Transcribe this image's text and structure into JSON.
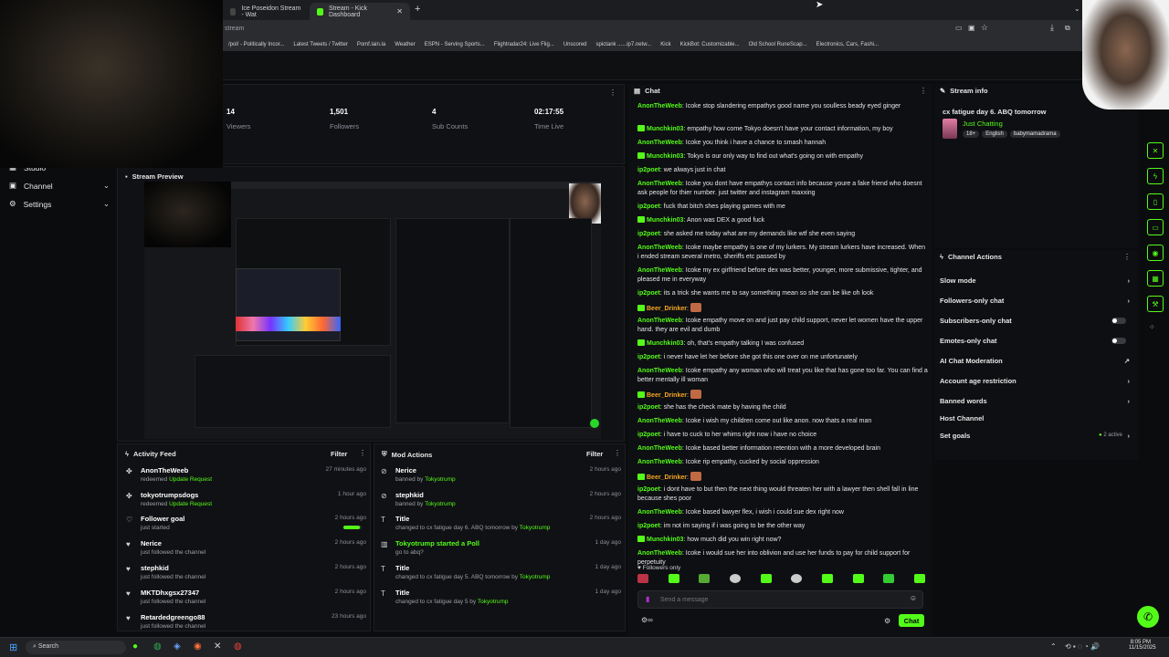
{
  "browser": {
    "tabs": [
      {
        "label": "Ice Poseidon Stream - Wat"
      },
      {
        "label": "Stream - Kick Dashboard"
      }
    ],
    "url_fragment": "stream",
    "bookmarks": [
      "/pol/ - Politically Incor...",
      "Latest Tweets / Twitter",
      "Pomf.lain.la",
      "Weather",
      "ESPN - Serving Sports...",
      "Flightradar24: Live Flig...",
      "Unscored",
      "spictank ......ip7.netw...",
      "Kick",
      "KickBot: Customizable...",
      "Old School RuneScap...",
      "Electronics, Cars, Fashi..."
    ]
  },
  "leftnav": {
    "items": [
      {
        "label": "Studio"
      },
      {
        "label": "Channel"
      },
      {
        "label": "Settings"
      }
    ]
  },
  "stats": [
    {
      "value": "14",
      "label": "Viewers"
    },
    {
      "value": "1,501",
      "label": "Followers"
    },
    {
      "value": "4",
      "label": "Sub Counts"
    },
    {
      "value": "02:17:55",
      "label": "Time Live"
    }
  ],
  "preview": {
    "title": "Stream Preview"
  },
  "activity_feed": {
    "title": "Activity Feed",
    "filter": "Filter",
    "items": [
      {
        "icon": "gift",
        "name": "AnonTheWeeb",
        "sub": "redeemed",
        "sub_hl": "Update Request",
        "time": "27 minutes ago"
      },
      {
        "icon": "gift",
        "name": "tokyotrumpsdogs",
        "sub": "redeemed",
        "sub_hl": "Update Request",
        "time": "1 hour ago"
      },
      {
        "icon": "heart-outline",
        "name": "Follower goal",
        "sub": "just started",
        "sub_hl": "",
        "time": "2 hours ago",
        "progress": 0.9
      },
      {
        "icon": "heart",
        "name": "Nerice",
        "sub": "just followed the channel",
        "sub_hl": "",
        "time": "2 hours ago"
      },
      {
        "icon": "heart",
        "name": "stephkid",
        "sub": "just followed the channel",
        "sub_hl": "",
        "time": "2 hours ago"
      },
      {
        "icon": "heart",
        "name": "MKTDhxgsx27347",
        "sub": "just followed the channel",
        "sub_hl": "",
        "time": "2 hours ago"
      },
      {
        "icon": "heart",
        "name": "Retardedgreengo88",
        "sub": "just followed the channel",
        "sub_hl": "",
        "time": "23 hours ago"
      }
    ]
  },
  "mod_actions": {
    "title": "Mod Actions",
    "filter": "Filter",
    "items": [
      {
        "icon": "ban",
        "name": "Nerice",
        "sub": "banned by",
        "by": "Tokyotrump",
        "time": "2 hours ago"
      },
      {
        "icon": "ban",
        "name": "stephkid",
        "sub": "banned by",
        "by": "Tokyotrump",
        "time": "2 hours ago"
      },
      {
        "icon": "title",
        "name": "Title",
        "sub": "changed to cx fatigue day 6. ABQ tomorrow by",
        "by": "Tokyotrump",
        "time": "2 hours ago"
      },
      {
        "icon": "poll",
        "name": "Tokyotrump started a Poll",
        "sub": "go to abq?",
        "by": "",
        "time": "1 day ago"
      },
      {
        "icon": "title",
        "name": "Title",
        "sub": "changed to cx fatigue day 5. ABQ tomorrow by",
        "by": "Tokyotrump",
        "time": "1 day ago"
      },
      {
        "icon": "title",
        "name": "Title",
        "sub": "changed to cx fatigue day 5 by",
        "by": "Tokyotrump",
        "time": "1 day ago"
      }
    ]
  },
  "chat": {
    "title": "Chat",
    "followers_only": "Followers only",
    "placeholder": "Send a message",
    "send": "Chat",
    "messages": [
      {
        "user": "AnonTheWeeb",
        "color": "#53fc18",
        "badge": false,
        "text": "Icoke stop slandering empathys good name you soulless beady eyed ginger"
      },
      {
        "user": "Munchkin03",
        "color": "#53fc18",
        "badge": true,
        "text": "empathy how come Tokyo doesn't have your contact information, my boy"
      },
      {
        "user": "AnonTheWeeb",
        "color": "#53fc18",
        "badge": false,
        "text": "Icoke you think i have a chance to smash hannah"
      },
      {
        "user": "Munchkin03",
        "color": "#53fc18",
        "badge": true,
        "text": "Tokyo is our only way to find out what's going on with empathy"
      },
      {
        "user": "ip2poet",
        "color": "#53fc18",
        "badge": false,
        "text": "we always just in chat"
      },
      {
        "user": "AnonTheWeeb",
        "color": "#53fc18",
        "badge": false,
        "text": "Icoke you dont have empathys contact info because youre a fake friend who doesnt ask people for thier number. just twitter and instagram maxxing"
      },
      {
        "user": "ip2poet",
        "color": "#53fc18",
        "badge": false,
        "text": "fuck that bitch shes playing games with me"
      },
      {
        "user": "Munchkin03",
        "color": "#53fc18",
        "badge": true,
        "text": "Anon was DEX a good fuck"
      },
      {
        "user": "ip2poet",
        "color": "#53fc18",
        "badge": false,
        "text": "she asked me today what are my demands like wtf she even saying"
      },
      {
        "user": "AnonTheWeeb",
        "color": "#53fc18",
        "badge": false,
        "text": "Icoke maybe empathy is one of my lurkers. My stream lurkers have increased. When i ended stream several metro, sheriffs etc passed by"
      },
      {
        "user": "AnonTheWeeb",
        "color": "#53fc18",
        "badge": false,
        "text": "Icoke my ex girlfriend before dex was better, younger, more submissive, tighter, and pleased me in everyway"
      },
      {
        "user": "ip2poet",
        "color": "#53fc18",
        "badge": false,
        "text": "its a trick she wants me to say something mean so she can be like oh look"
      },
      {
        "user": "Beer_Drinker",
        "color": "#f5a623",
        "badge": true,
        "text": "",
        "emote": true
      },
      {
        "user": "AnonTheWeeb",
        "color": "#53fc18",
        "badge": false,
        "text": "Icoke empathy move on and just pay child support, never let women have the upper hand. they are evil and dumb"
      },
      {
        "user": "Munchkin03",
        "color": "#53fc18",
        "badge": true,
        "text": "oh, that's empathy talking I was confused"
      },
      {
        "user": "ip2poet",
        "color": "#53fc18",
        "badge": false,
        "text": "i never have let her before she got this one over on me unfortunately"
      },
      {
        "user": "AnonTheWeeb",
        "color": "#53fc18",
        "badge": false,
        "text": "Icoke empathy any woman who will treat you like that has gone too far. You can find a better mentally ill woman"
      },
      {
        "user": "Beer_Drinker",
        "color": "#f5a623",
        "badge": true,
        "text": "",
        "emote": true
      },
      {
        "user": "ip2poet",
        "color": "#53fc18",
        "badge": false,
        "text": "she has the check mate by having the child"
      },
      {
        "user": "AnonTheWeeb",
        "color": "#53fc18",
        "badge": false,
        "text": "Icoke i wish my children come out like anon. now thats a real man"
      },
      {
        "user": "ip2poet",
        "color": "#53fc18",
        "badge": false,
        "text": "i have to cuck to her whims right now i have no choice"
      },
      {
        "user": "AnonTheWeeb",
        "color": "#53fc18",
        "badge": false,
        "text": "Icoke based better information retention with a more developed brain"
      },
      {
        "user": "AnonTheWeeb",
        "color": "#53fc18",
        "badge": false,
        "text": "Icoke rip empathy, cucked by social oppression"
      },
      {
        "user": "Beer_Drinker",
        "color": "#f5a623",
        "badge": true,
        "text": "",
        "emote": true
      },
      {
        "user": "ip2poet",
        "color": "#53fc18",
        "badge": false,
        "text": "i dont have to but then the next thing would threaten her with a lawyer then shell fall in line because shes poor"
      },
      {
        "user": "AnonTheWeeb",
        "color": "#53fc18",
        "badge": false,
        "text": "Icoke based lawyer flex, i wish i could sue dex right now"
      },
      {
        "user": "ip2poet",
        "color": "#53fc18",
        "badge": false,
        "text": "im not im saying if i was going to be the other way"
      },
      {
        "user": "Munchkin03",
        "color": "#53fc18",
        "badge": true,
        "text": "how much did you win right now?"
      },
      {
        "user": "AnonTheWeeb",
        "color": "#53fc18",
        "badge": false,
        "text": "Icoke i would sue her into oblivion and use her funds to pay for child support for perpetuity"
      }
    ]
  },
  "stream_info": {
    "title": "Stream info",
    "stream_title": "cx fatigue day 6. ABQ tomorrow",
    "category": "Just Chatting",
    "tags": [
      "18+",
      "English",
      "babymamadrama"
    ]
  },
  "channel_actions": {
    "title": "Channel Actions",
    "items": [
      {
        "label": "Slow mode",
        "control": "chevron"
      },
      {
        "label": "Followers-only chat",
        "control": "chevron"
      },
      {
        "label": "Subscribers-only chat",
        "control": "toggle"
      },
      {
        "label": "Emotes-only chat",
        "control": "toggle"
      },
      {
        "label": "AI Chat Moderation",
        "control": "external"
      },
      {
        "label": "Account age restriction",
        "control": "chevron"
      },
      {
        "label": "Banned words",
        "control": "chevron"
      },
      {
        "label": "Host Channel",
        "control": "none"
      },
      {
        "label": "Set goals",
        "control": "chevron",
        "extra": "2 active"
      }
    ]
  },
  "taskbar": {
    "search": "Search",
    "time": "8:05 PM",
    "date": "11/15/2025"
  },
  "colors": {
    "accent": "#53fc18",
    "bg": "#0b0c0e",
    "panel": "#101114"
  }
}
